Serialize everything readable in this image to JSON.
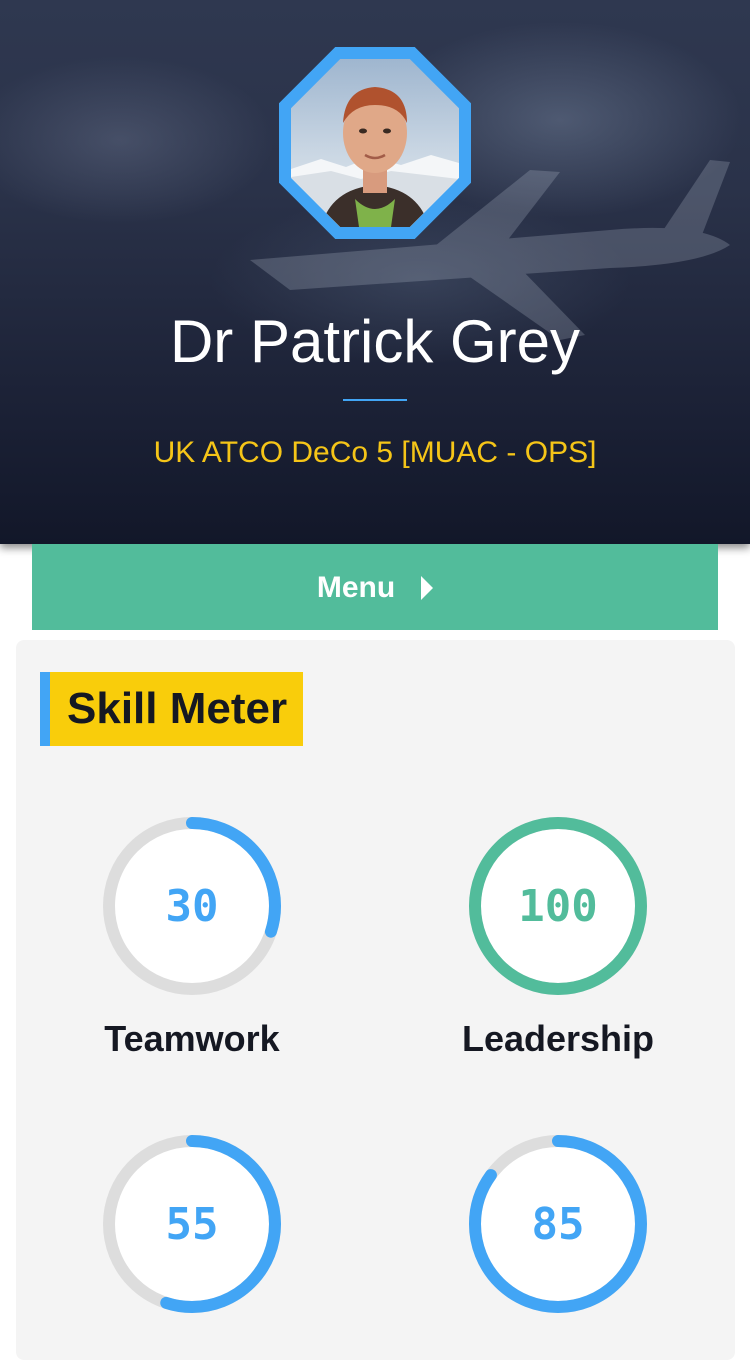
{
  "profile": {
    "name": "Dr Patrick Grey",
    "role": "UK ATCO DeCo 5 [MUAC - OPS]",
    "avatar_icon": "person-photo"
  },
  "menu": {
    "label": "Menu",
    "icon": "caret-right-icon"
  },
  "skills_section": {
    "title": "Skill Meter",
    "skills": [
      {
        "label": "Teamwork",
        "value": "30",
        "percent": 30,
        "color": "#42a5f5"
      },
      {
        "label": "Leadership",
        "value": "100",
        "percent": 100,
        "color": "#52bc9b"
      },
      {
        "label": "",
        "value": "55",
        "percent": 55,
        "color": "#42a5f5"
      },
      {
        "label": "",
        "value": "85",
        "percent": 85,
        "color": "#42a5f5"
      }
    ]
  },
  "colors": {
    "accent_blue": "#42a5f5",
    "accent_green": "#52bc9b",
    "accent_yellow": "#f9cd0b",
    "track_gray": "#dddddd"
  }
}
